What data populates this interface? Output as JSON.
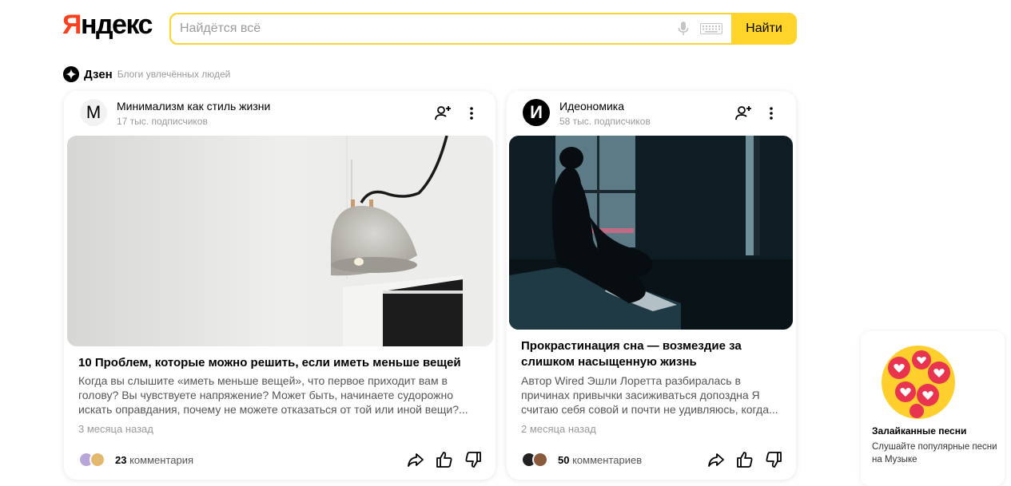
{
  "header": {
    "logo_first": "Я",
    "logo_rest": "ндекс",
    "search_placeholder": "Найдётся всё",
    "search_value": "",
    "find_button": "Найти"
  },
  "dzen": {
    "title": "Дзен",
    "subtitle": "Блоги увлечённых людей"
  },
  "cards": [
    {
      "avatar_letter": "М",
      "channel": "Минимализм как стиль жизни",
      "subscribers": "17 тыс. подписчиков",
      "title": "10 Проблем, которые можно решить, если иметь меньше вещей",
      "excerpt": "Когда вы слышите «иметь меньше вещей», что первое приходит вам в голову? Вы чувствуете напряжение? Может быть, начинаете судорожно искать оправдания, почему не можете отказаться от той или иной вещи?...",
      "date": "3 месяца назад",
      "comments_count": "23",
      "comments_label": "комментария"
    },
    {
      "avatar_letter": "И",
      "channel": "Идеономика",
      "subscribers": "58 тыс. подписчиков",
      "title": "Прокрастинация сна — возмездие за слишком насыщенную жизнь",
      "excerpt": "Автор Wired Эшли Лоретта разбиралась в причинах привычки засиживаться допоздна Я считаю себя совой и почти не удивляюсь, когда...",
      "date": "2 месяца назад",
      "comments_count": "50",
      "comments_label": "комментариев"
    }
  ],
  "promo": {
    "title": "Залайканные песни",
    "text": "Слушайте популярные песни на Музыке"
  },
  "colors": {
    "brand_red": "#fc3f1d",
    "search_yellow": "#fed42b"
  }
}
